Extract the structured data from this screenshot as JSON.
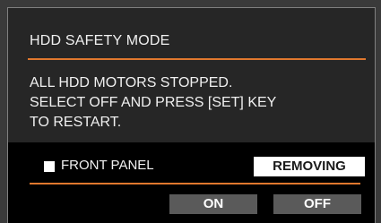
{
  "dialog": {
    "title": "HDD SAFETY MODE",
    "message_lines": [
      "ALL HDD MOTORS STOPPED.",
      "SELECT OFF AND PRESS [SET] KEY",
      "TO RESTART."
    ]
  },
  "panel": {
    "label": "FRONT PANEL",
    "status": "REMOVING"
  },
  "buttons": {
    "on_label": "ON",
    "off_label": "OFF"
  },
  "colors": {
    "accent": "#e0782e",
    "dialog_bg": "#262626",
    "panel_bg": "#000000",
    "button_bg": "#5a5a5a"
  }
}
